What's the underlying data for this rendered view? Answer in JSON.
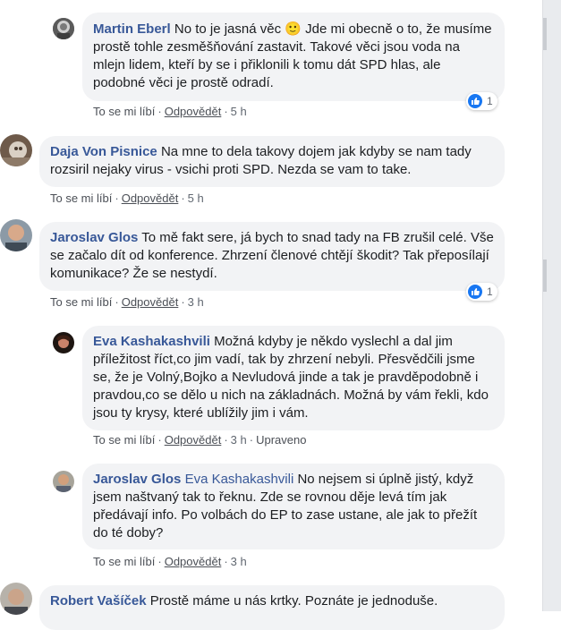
{
  "comments": [
    {
      "author": "Martin Eberl",
      "text_before": "No to je jasná věc",
      "emoji": "🙂",
      "text_after": "Jde mi obecně o to, že musíme prostě tohle zesměšňování zastavit. Takové věci jsou voda na mlejn lidem, kteří by se i přiklonili k tomu dát SPD hlas, ale podobné věci je prostě odradí.",
      "like_label": "To se mi líbí",
      "reply_label": "Odpovědět",
      "time": "5 h",
      "reactions": "1"
    },
    {
      "author": "Daja Von Pisnice",
      "text": "Na mne to dela takovy dojem jak kdyby se nam tady rozsiril nejaky virus - vsichi proti SPD. Nezda se vam to take.",
      "like_label": "To se mi líbí",
      "reply_label": "Odpovědět",
      "time": "5 h"
    },
    {
      "author": "Jaroslav Glos",
      "text": "To mě fakt sere, já bych to snad tady na FB zrušil celé. Vše se začalo dít od konference. Zhrzení členové chtějí škodit? Tak přeposílají komunikace? Že se nestydí.",
      "like_label": "To se mi líbí",
      "reply_label": "Odpovědět",
      "time": "3 h",
      "reactions": "1"
    },
    {
      "author": "Eva Kashakashvili",
      "text": "Možná kdyby je někdo vyslechl a dal jim příležitost říct,co jim vadí, tak by zhrzení nebyli. Přesvědčili jsme se, že je Volný,Bojko a Nevludová jinde a tak je pravděpodobně i pravdou,co se dělo u nich na základnách. Možná by vám řekli, kdo jsou ty krysy, které ublížily jim i vám.",
      "like_label": "To se mi líbí",
      "reply_label": "Odpovědět",
      "time": "3 h",
      "edited": "Upraveno"
    },
    {
      "author": "Jaroslav Glos",
      "mention": "Eva Kashakashvili",
      "text": "No nejsem si úplně jistý, když jsem naštvaný tak to řeknu. Zde se rovnou děje levá tím jak předávají info. Po volbách do EP to zase ustane, ale jak to přežít do té doby?",
      "like_label": "To se mi líbí",
      "reply_label": "Odpovědět",
      "time": "3 h"
    },
    {
      "author": "Robert Vašíček",
      "text": "Prostě máme u nás krtky. Poznáte je jednoduše."
    }
  ],
  "colors": {
    "author": "#385898",
    "bubble": "#f2f3f5",
    "meta": "#606770",
    "like": "#1877f2"
  }
}
